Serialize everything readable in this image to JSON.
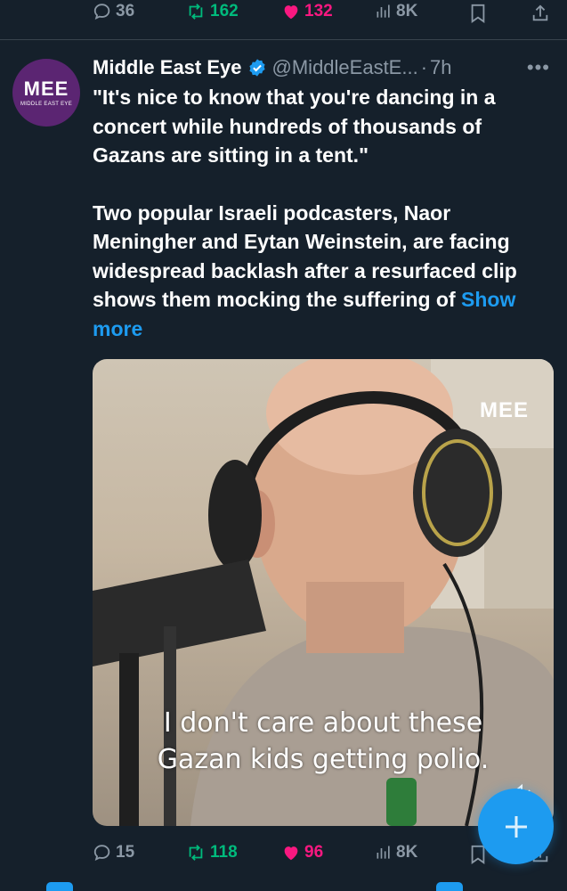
{
  "colors": {
    "background": "#15202b",
    "accent": "#1d9bf0",
    "retweet": "#00ba7c",
    "like": "#f91880",
    "muted": "#8b98a5"
  },
  "top_actions": {
    "replies": "36",
    "reposts": "162",
    "likes": "132",
    "views": "8K"
  },
  "tweet": {
    "author_name": "Middle East Eye",
    "handle": "@MiddleEastE...",
    "time": "7h",
    "avatar_logo": "MEE",
    "avatar_subtitle": "MIDDLE EAST EYE",
    "text_paragraph_1": "\"It's nice to know that you're dancing in a concert while hundreds of thousands of Gazans are sitting in a tent.\"",
    "text_paragraph_2": "Two popular Israeli podcasters, Naor Meningher and Eytan Weinstein, are facing widespread backlash after a resurfaced clip shows them mocking the suffering of",
    "show_more": "Show more",
    "media": {
      "caption_line_1": "I don't care about these",
      "caption_line_2": "Gazan kids getting polio.",
      "watermark": "MEE"
    },
    "actions": {
      "replies": "15",
      "reposts": "118",
      "likes": "96",
      "views": "8K"
    }
  },
  "icons": [
    "reply-icon",
    "repost-icon",
    "heart-icon",
    "views-icon",
    "bookmark-icon",
    "share-icon",
    "verified-icon",
    "more-icon",
    "mute-icon",
    "compose-icon"
  ]
}
